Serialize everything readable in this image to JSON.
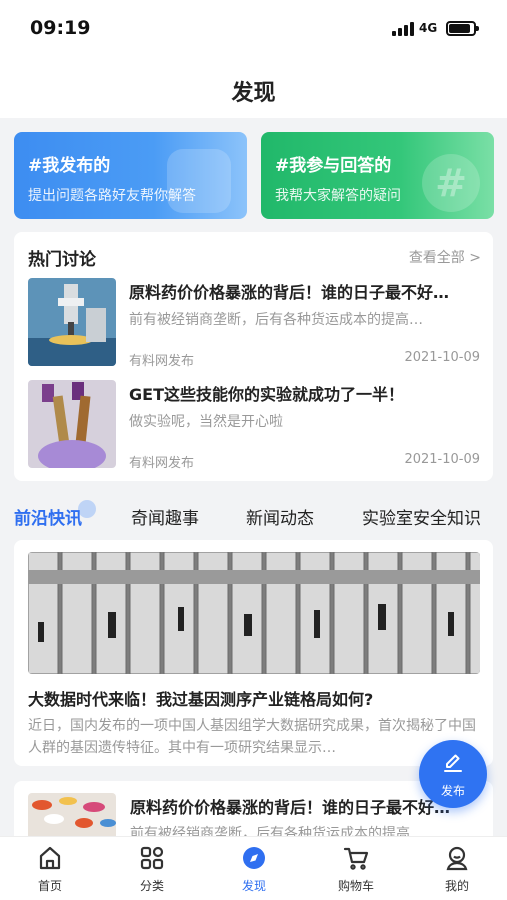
{
  "status_bar": {
    "time": "09:19",
    "network": "4G"
  },
  "header": {
    "title": "发现"
  },
  "banners": [
    {
      "title": "#我发布的",
      "subtitle": "提出问题各路好友帮你解答"
    },
    {
      "title": "#我参与回答的",
      "subtitle": "我帮大家解答的疑问"
    }
  ],
  "hot": {
    "title": "热门讨论",
    "see_all": "查看全部 >",
    "items": [
      {
        "title": "原料药价价格暴涨的背后！谁的日子最不好…",
        "desc": "前有被经销商垄断，后有各种货运成本的提高…",
        "source": "有料网发布",
        "date": "2021-10-09"
      },
      {
        "title": "GET这些技能你的实验就成功了一半！",
        "desc": "做实验呢，当然是开心啦",
        "source": "有料网发布",
        "date": "2021-10-09"
      }
    ]
  },
  "tabs": [
    "前沿快讯",
    "奇闻趣事",
    "新闻动态",
    "实验室安全知识"
  ],
  "news": [
    {
      "title": "大数据时代来临！我过基因测序产业链格局如何?",
      "desc": "近日，国内发布的一项中国人基因组学大数据研究成果，首次揭秘了中国人群的基因遗传特征。其中有一项研究结果显示…"
    },
    {
      "title": "原料药价价格暴涨的背后！谁的日子最不好…",
      "desc": "前有被经销商垄断，后有各种货运成本的提高…"
    }
  ],
  "fab": {
    "label": "发布"
  },
  "nav": [
    {
      "label": "首页",
      "icon": "home-icon"
    },
    {
      "label": "分类",
      "icon": "category-icon"
    },
    {
      "label": "发现",
      "icon": "compass-icon"
    },
    {
      "label": "购物车",
      "icon": "cart-icon"
    },
    {
      "label": "我的",
      "icon": "profile-icon"
    }
  ],
  "colors": {
    "accent": "#2f6ff0",
    "banner_blue": "#3d8df1",
    "banner_green": "#21b86a"
  }
}
